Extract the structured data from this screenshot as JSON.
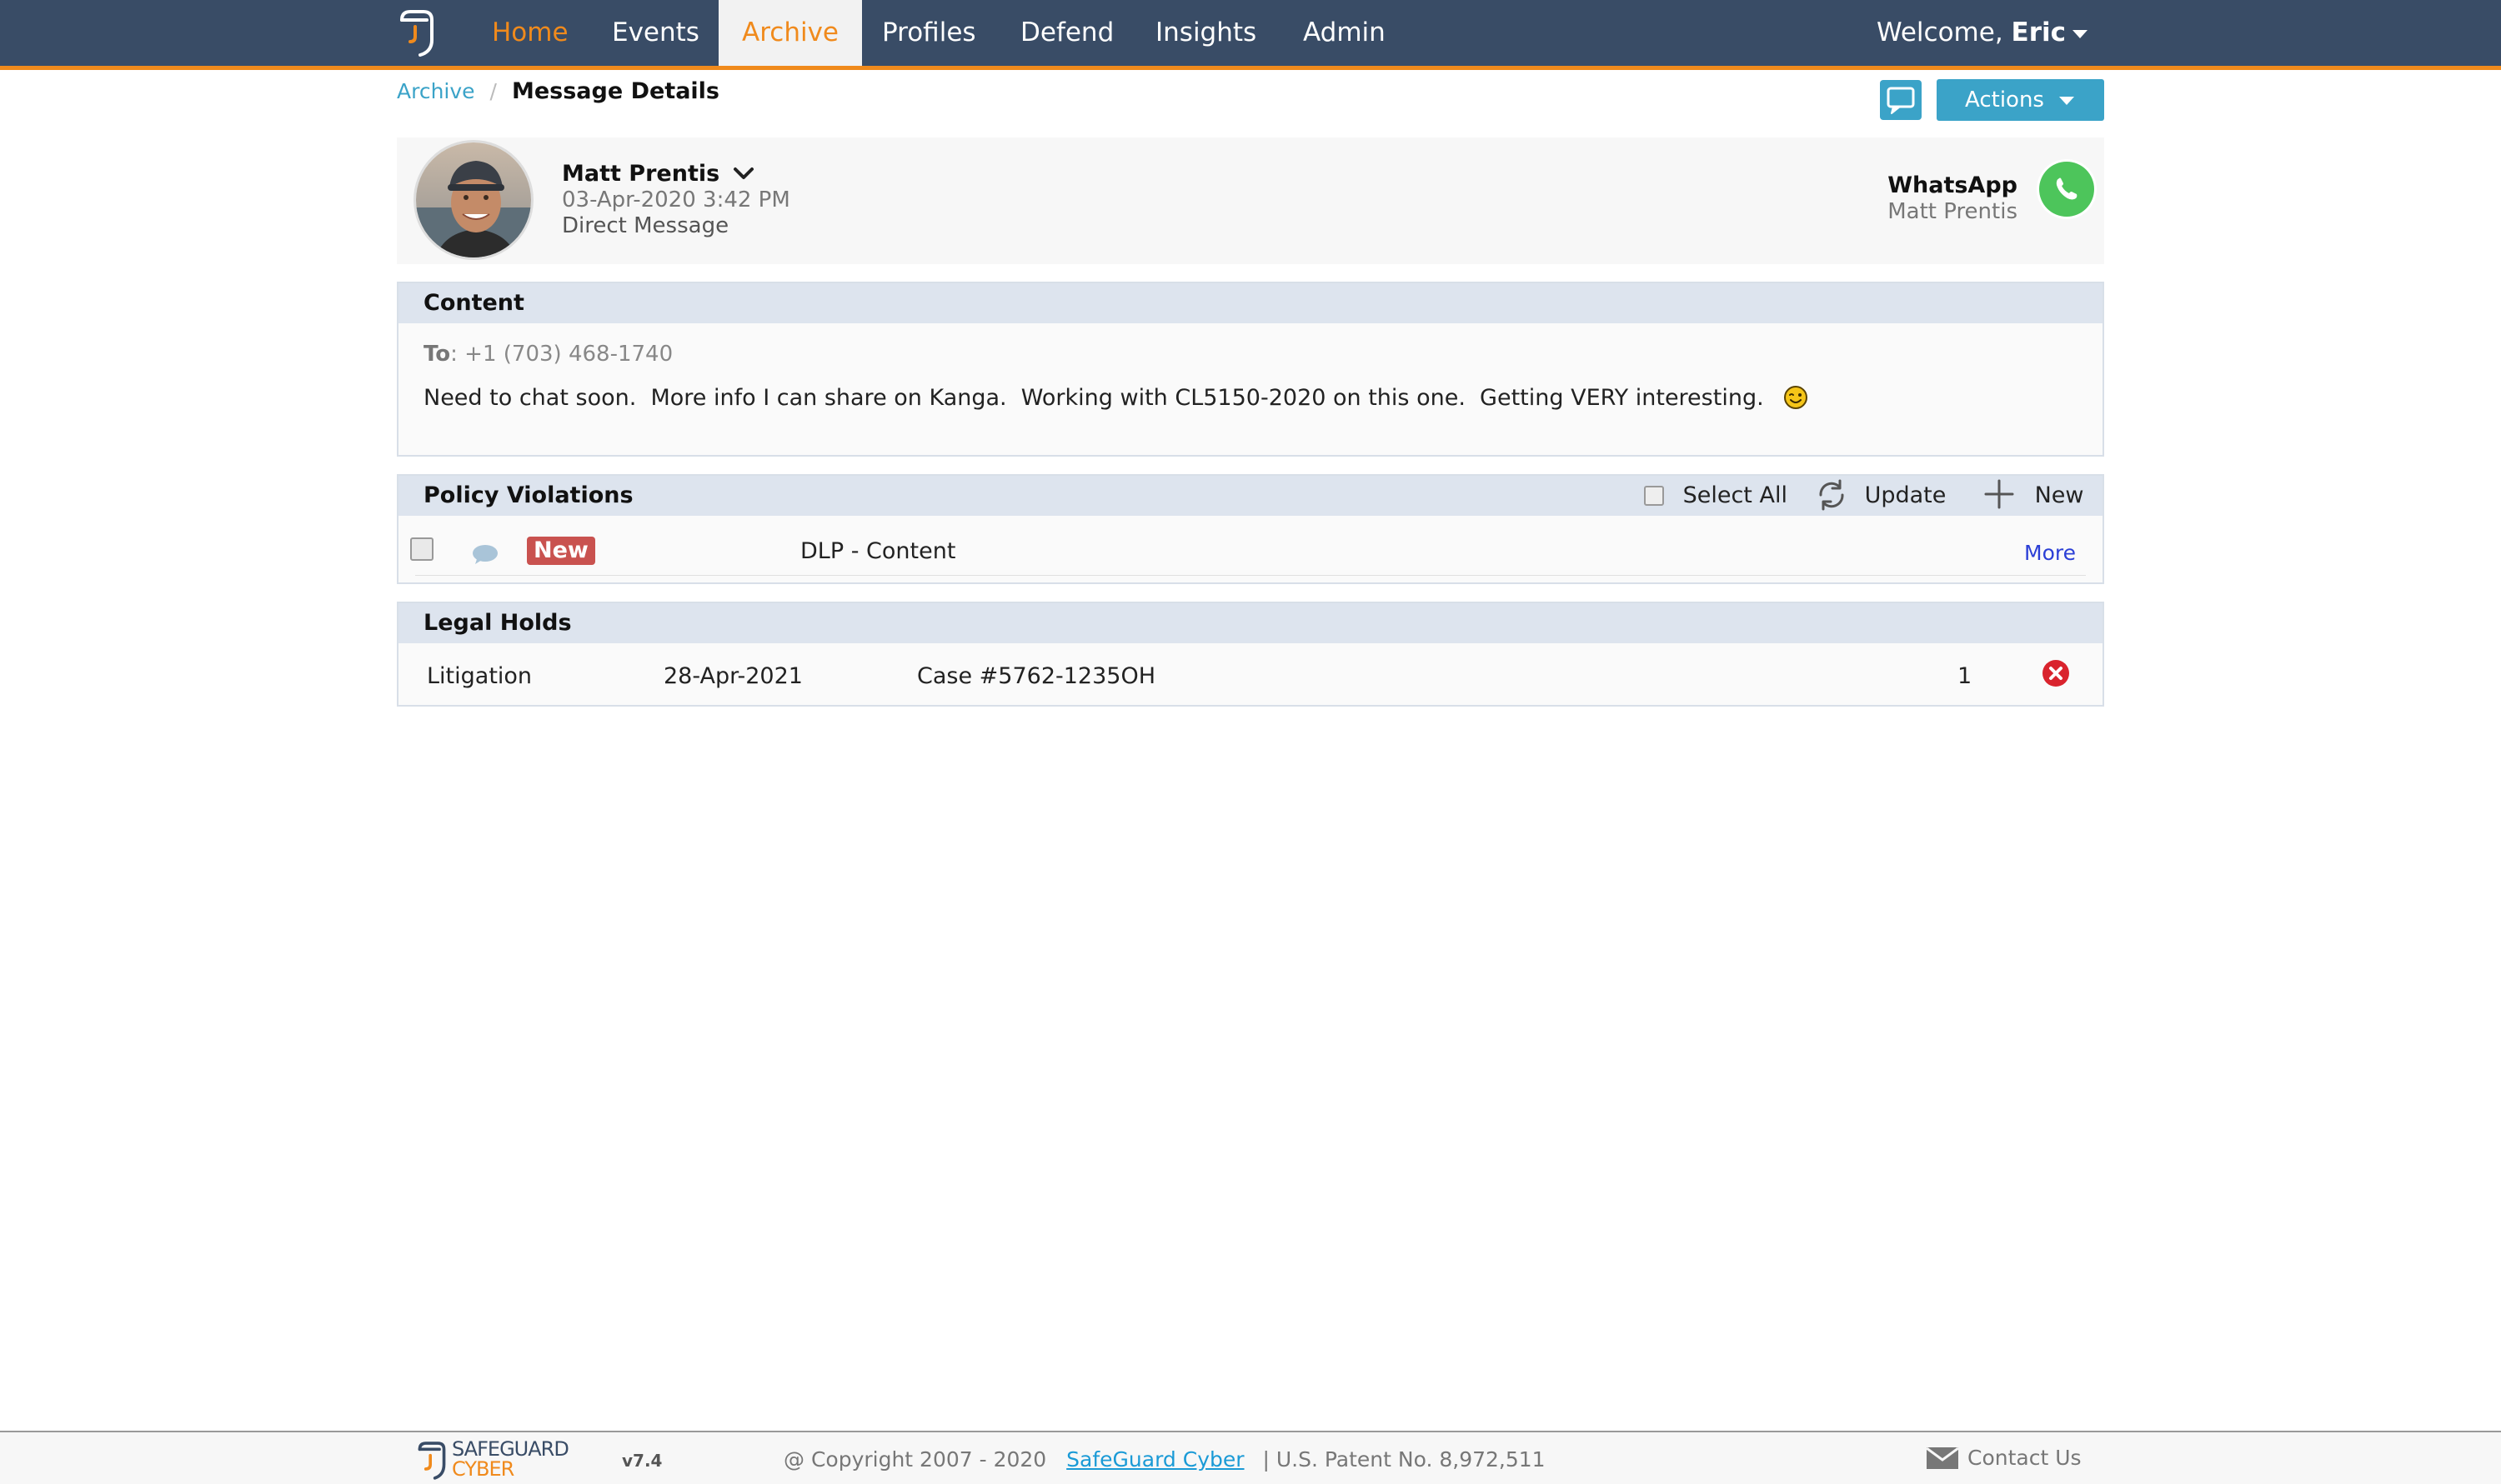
{
  "nav": {
    "items": [
      {
        "label": "Home"
      },
      {
        "label": "Events"
      },
      {
        "label": "Archive"
      },
      {
        "label": "Profiles"
      },
      {
        "label": "Defend"
      },
      {
        "label": "Insights"
      },
      {
        "label": "Admin"
      }
    ],
    "active": "Archive",
    "welcome_prefix": "Welcome, ",
    "user_name": "Eric"
  },
  "breadcrumb": {
    "parent": "Archive",
    "separator": "/",
    "current": "Message Details"
  },
  "toolbar": {
    "actions_label": "Actions",
    "chat_icon": "chat-bubble-icon"
  },
  "message": {
    "sender_name": "Matt Prentis",
    "date": "03-Apr-2020 3:42 PM",
    "type": "Direct Message",
    "platform": "WhatsApp",
    "platform_user": "Matt Prentis"
  },
  "content": {
    "heading": "Content",
    "to_label": "To",
    "to_value": ": +1 (703) 468-1740",
    "body": "Need to chat soon.  More info I can share on Kanga.  Working with CL5150-2020 on this one.  Getting VERY interesting."
  },
  "policy_violations": {
    "heading": "Policy Violations",
    "select_all": "Select All",
    "update": "Update",
    "new": "New",
    "rows": [
      {
        "status": "New",
        "policy": "DLP - Content",
        "more": "More"
      }
    ]
  },
  "legal_holds": {
    "heading": "Legal Holds",
    "rows": [
      {
        "type": "Litigation",
        "date": "28-Apr-2021",
        "case": "Case #5762-1235OH",
        "count": "1"
      }
    ]
  },
  "footer": {
    "logo_text_top": "SAFEGUARD",
    "logo_text_bottom": "CYBER",
    "version": "v7.4",
    "copyright": "@ Copyright 2007 - 2020",
    "company_link": "SafeGuard Cyber",
    "patent": "|  U.S. Patent No. 8,972,511",
    "contact": "Contact Us"
  },
  "colors": {
    "nav_bg": "#394c66",
    "accent_orange": "#f08a1c",
    "button_blue": "#3ba3c8",
    "badge_red": "#c9524f",
    "panel_head": "#dde4ee",
    "whatsapp_green": "#4dc55b"
  }
}
